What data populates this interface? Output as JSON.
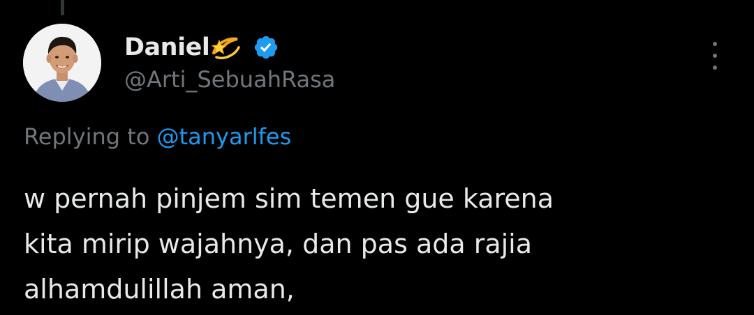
{
  "author": {
    "display_name": "Daniel",
    "name_emoji": "💫",
    "handle": "@Arti_SebuahRasa",
    "verified": true
  },
  "reply_context": {
    "prefix": "Replying to",
    "mention": "@tanyarlfes"
  },
  "tweet": {
    "text": "w pernah pinjem sim temen gue karena\nkita mirip wajahnya, dan pas ada rajia\nalhamdulillah aman,"
  },
  "colors": {
    "background": "#000000",
    "text_primary": "#e7e9ea",
    "text_secondary": "#71767b",
    "accent": "#1d9bf0"
  },
  "icons": {
    "verified": "verified-badge-icon",
    "more": "more-options-icon",
    "emoji": "dizzy-star-emoji"
  }
}
